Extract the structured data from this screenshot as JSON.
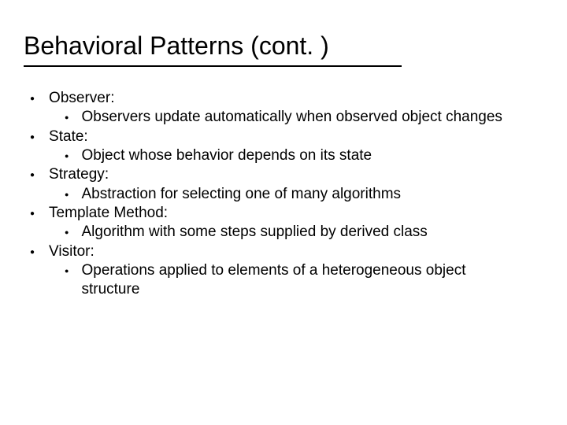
{
  "title": "Behavioral Patterns (cont. )",
  "items": [
    {
      "name": "Observer",
      "desc": "Observers update automatically when observed object changes"
    },
    {
      "name": "State",
      "desc": "Object whose behavior depends on its state"
    },
    {
      "name": "Strategy",
      "desc": "Abstraction for selecting one of many algorithms"
    },
    {
      "name": "Template Method",
      "desc": "Algorithm with some steps supplied by derived class"
    },
    {
      "name": "Visitor",
      "desc": "Operations applied to elements of a heterogeneous object structure"
    }
  ],
  "colon": ":"
}
